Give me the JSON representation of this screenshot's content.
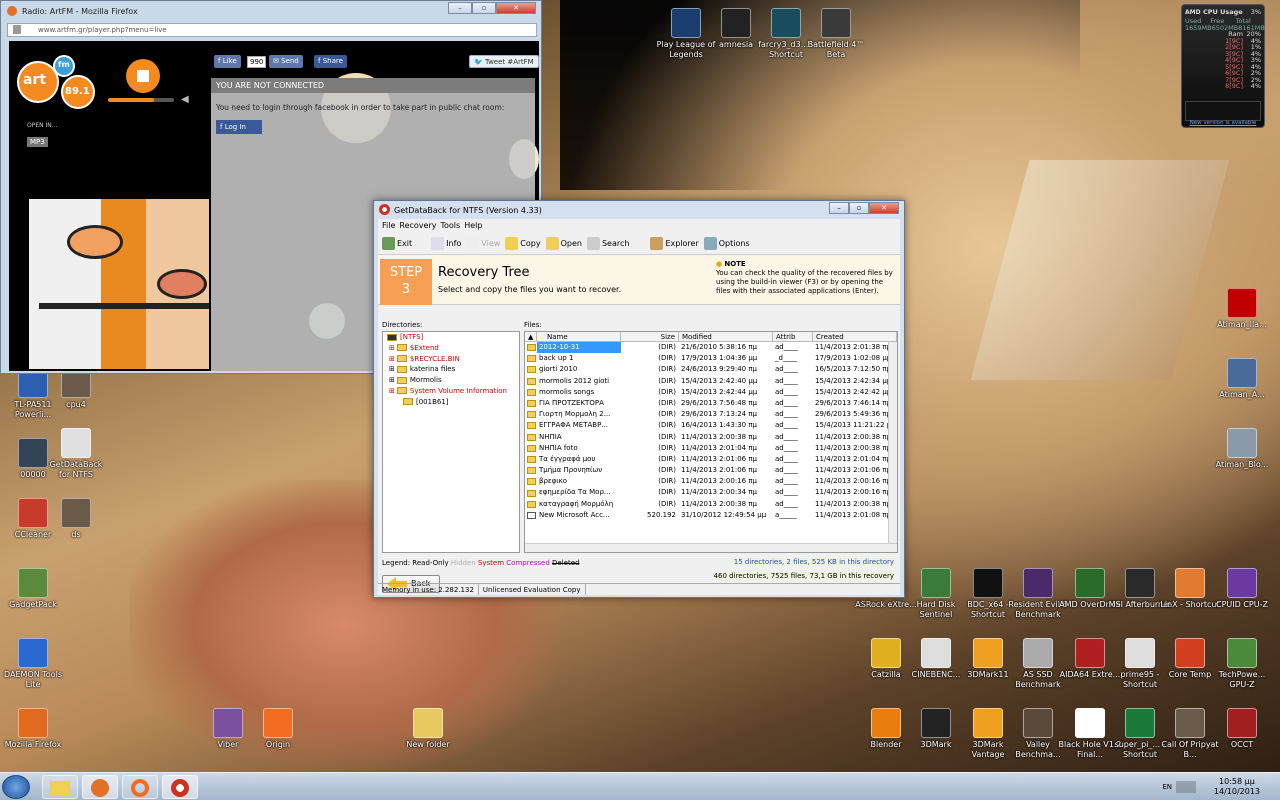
{
  "firefox": {
    "title": "Radio: ArtFM - Mozilla Firefox",
    "url": "www.artfm.gr/player.php?menu=live",
    "like_label": "Like",
    "like_count": "990",
    "send_label": "Send",
    "share_label": "Share",
    "tweet_label": "Tweet #ArtFM",
    "logo_text": "art",
    "logo_fm": "fm",
    "logo_freq": "89.1",
    "open_in": "OPEN IN...",
    "mp3": "MP3",
    "chat_header": "YOU ARE NOT CONNECTED",
    "chat_message": "You need to login through facebook in order to take part in public chat room:",
    "fb_login": "Log In"
  },
  "getdataback": {
    "title": "GetDataBack for NTFS (Version 4.33)",
    "menu": [
      "File",
      "Recovery",
      "Tools",
      "Help"
    ],
    "toolbar": [
      "Exit",
      "Info",
      "View",
      "Copy",
      "Open",
      "Search",
      "Explorer",
      "Options"
    ],
    "step_label": "STEP",
    "step_num": "3",
    "heading": "Recovery Tree",
    "subheading": "Select and copy the files you want to recover.",
    "note_title": "NOTE",
    "note_text": "You can check the quality of the recovered files by using the build-in viewer (F3) or by opening the files with their associated applications (Enter).",
    "directories_label": "Directories:",
    "files_label": "Files:",
    "tree": [
      {
        "name": "[NTFS]",
        "color": "#d00000"
      },
      {
        "name": "$Extend",
        "color": "#d00000"
      },
      {
        "name": "$RECYCLE.BIN",
        "color": "#d00000"
      },
      {
        "name": "katerina files",
        "color": "#000000"
      },
      {
        "name": "Mormolis",
        "color": "#000000"
      },
      {
        "name": "System Volume Information",
        "color": "#d00000"
      },
      {
        "name": "[001B61]",
        "color": "#000000"
      }
    ],
    "columns": [
      "Name",
      "Size",
      "Modified",
      "Attrib",
      "Created"
    ],
    "files": [
      [
        "2012-10-31",
        "(DIR)",
        "21/6/2010 5:38:16 πμ",
        "ad____",
        "11/4/2013 2:01:38 πμ"
      ],
      [
        "back up 1",
        "(DIR)",
        "17/9/2013 1:04:36 μμ",
        "_d____",
        "17/9/2013 1:02:08 μμ"
      ],
      [
        "giorti 2010",
        "(DIR)",
        "24/6/2013 9:29:40 πμ",
        "ad____",
        "16/5/2013 7:12:50 πμ"
      ],
      [
        "mormolis 2012 gioti",
        "(DIR)",
        "15/4/2013 2:42:40 μμ",
        "ad____",
        "15/4/2013 2:42:34 μμ"
      ],
      [
        "mormolis songs",
        "(DIR)",
        "15/4/2013 2:42:44 μμ",
        "ad____",
        "15/4/2013 2:42:42 μμ"
      ],
      [
        "ΓΙΑ ΠΡΟΤΖΕΚΤΟΡΑ",
        "(DIR)",
        "29/6/2013 7:56:48 πμ",
        "ad____",
        "29/6/2013 7:46:14 πμ"
      ],
      [
        "Γιορτη Μορμολη 2...",
        "(DIR)",
        "29/6/2013 7:13:24 πμ",
        "ad____",
        "29/6/2013 5:49:36 πμ"
      ],
      [
        "ΕΓΓΡΑΦΑ ΜΕΤΑΒΡ...",
        "(DIR)",
        "16/4/2013 1:43:30 πμ",
        "ad____",
        "15/4/2013 11:21:22 μμ"
      ],
      [
        "ΝΗΠΙΑ",
        "(DIR)",
        "11/4/2013 2:00:38 πμ",
        "ad____",
        "11/4/2013 2:00:38 πμ"
      ],
      [
        "ΝΗΠΙΑ foto",
        "(DIR)",
        "11/4/2013 2:01:04 πμ",
        "ad____",
        "11/4/2013 2:00:38 πμ"
      ],
      [
        "Τα έγγραφά μου",
        "(DIR)",
        "11/4/2013 2:01:06 πμ",
        "ad____",
        "11/4/2013 2:01:04 πμ"
      ],
      [
        "Τμήμα Προνηπίων",
        "(DIR)",
        "11/4/2013 2:01:06 πμ",
        "ad____",
        "11/4/2013 2:01:06 πμ"
      ],
      [
        "βρεφικο",
        "(DIR)",
        "11/4/2013 2:00:16 πμ",
        "ad____",
        "11/4/2013 2:00:16 πμ"
      ],
      [
        "εφημερίδα Τα Μορ...",
        "(DIR)",
        "11/4/2013 2:00:34 πμ",
        "ad____",
        "11/4/2013 2:00:16 πμ"
      ],
      [
        "καταγραφή Μορμόλη",
        "(DIR)",
        "11/4/2013 2:00:38 πμ",
        "ad____",
        "11/4/2013 2:00:38 πμ"
      ],
      [
        "New Microsoft Acc...",
        "520.192",
        "31/10/2012 12:49:54 μμ",
        "a_____",
        "11/4/2013 2:01:08 πμ"
      ]
    ],
    "legend_label": "Legend:",
    "legend": [
      {
        "name": "Read-Only",
        "color": "#000000"
      },
      {
        "name": "Hidden",
        "color": "#b0b0b0"
      },
      {
        "name": "System",
        "color": "#d00000"
      },
      {
        "name": "Compressed",
        "color": "#c000c0"
      },
      {
        "name": "Deleted",
        "color": "#000000"
      }
    ],
    "summary1": "15 directories, 2 files, 525 KB in this directory",
    "summary2": "460 directories, 7525 files, 73,1 GB in this recovery",
    "back_label": "Back",
    "status1": "Memory in use: 2.282.132",
    "status2": "Unlicensed Evaluation Copy"
  },
  "cpu_gadget": {
    "title": "CPU Usage",
    "percent": "3%",
    "brand": "AMD",
    "labels": [
      "Used",
      "Free",
      "Total"
    ],
    "values": [
      "1659MB",
      "6502MB",
      "8161MB"
    ],
    "ram_label": "Ram",
    "ram_pct": "20%",
    "cores": [
      [
        "1[9C]",
        "4%"
      ],
      [
        "2[9C]",
        "1%"
      ],
      [
        "3[9C]",
        "4%"
      ],
      [
        "4[9C]",
        "3%"
      ],
      [
        "5[9C]",
        "4%"
      ],
      [
        "6[9C]",
        "2%"
      ],
      [
        "7[9C]",
        "2%"
      ],
      [
        "8[9C]",
        "4%"
      ]
    ],
    "footer": "New version is available"
  },
  "desktop_icons": [
    {
      "label": "Play League of Legends",
      "color": "#1a3c6e"
    },
    {
      "label": "amnesia",
      "color": "#222222"
    },
    {
      "label": "farcry3_d3... - Shortcut",
      "color": "#1a4d5c"
    },
    {
      "label": "Battlefield 4™ Beta",
      "color": "#3a3a3a"
    },
    {
      "label": "TL-PA511 Powerli...",
      "color": "#2b5fb0"
    },
    {
      "label": "cpu4",
      "color": "#6a5a4a"
    },
    {
      "label": "00000",
      "color": "#334455"
    },
    {
      "label": "GetDataBack for NTFS",
      "color": "#e0e0e0"
    },
    {
      "label": "CCleaner",
      "color": "#c83a2a"
    },
    {
      "label": "ds",
      "color": "#6a5a4a"
    },
    {
      "label": "GadgetPack",
      "color": "#5a8a3a"
    },
    {
      "label": "DAEMON Tools Lite",
      "color": "#2a6ad0"
    },
    {
      "label": "Mozilla Firefox",
      "color": "#e06a20"
    },
    {
      "label": "Viber",
      "color": "#7b519d"
    },
    {
      "label": "Origin",
      "color": "#f26c22"
    },
    {
      "label": "New folder",
      "color": "#e8c860"
    },
    {
      "label": "Atiman_lla...",
      "color": "#c00000"
    },
    {
      "label": "Atiman_A...",
      "color": "#4a6a9a"
    },
    {
      "label": "Atiman_Blo...",
      "color": "#8a9aaa"
    },
    {
      "label": "ASRock eXtre...",
      "color": "#2a2a2a"
    },
    {
      "label": "Hard Disk Sentinel",
      "color": "#3a7a3a"
    },
    {
      "label": "BDC_x64 - Shortcut",
      "color": "#111111"
    },
    {
      "label": "Resident Evil 6 Benchmark",
      "color": "#4a2a6a"
    },
    {
      "label": "AMD OverDrive",
      "color": "#2a6a2a"
    },
    {
      "label": "MSI Afterburner",
      "color": "#2a2a2a"
    },
    {
      "label": "LinX - Shortcut",
      "color": "#e07a30"
    },
    {
      "label": "CPUID CPU-Z",
      "color": "#6a3aa0"
    },
    {
      "label": "Catzilla",
      "color": "#e0b020"
    },
    {
      "label": "CINEBENC...",
      "color": "#dddddd"
    },
    {
      "label": "3DMark11",
      "color": "#f0a020"
    },
    {
      "label": "AS SSD Benchmark",
      "color": "#aaaaaa"
    },
    {
      "label": "AIDA64 Extre...",
      "color": "#b02020"
    },
    {
      "label": "prime95 - Shortcut",
      "color": "#dddddd"
    },
    {
      "label": "Core Temp",
      "color": "#d04020"
    },
    {
      "label": "TechPowe... GPU-Z",
      "color": "#4a8a3a"
    },
    {
      "label": "Blender",
      "color": "#e87d0d"
    },
    {
      "label": "3DMark",
      "color": "#222222"
    },
    {
      "label": "3DMark Vantage",
      "color": "#f0a020"
    },
    {
      "label": "Valley Benchma...",
      "color": "#5a4a3a"
    },
    {
      "label": "Black Hole V1.2 Final...",
      "color": "#ffffff"
    },
    {
      "label": "super_pi_... - Shortcut",
      "color": "#1a7a3a"
    },
    {
      "label": "Call Of Pripyat B...",
      "color": "#6a5a4a"
    },
    {
      "label": "OCCT",
      "color": "#a02020"
    }
  ],
  "taskbar": {
    "lang": "EN",
    "time": "10:58 μμ",
    "date": "14/10/2013"
  }
}
